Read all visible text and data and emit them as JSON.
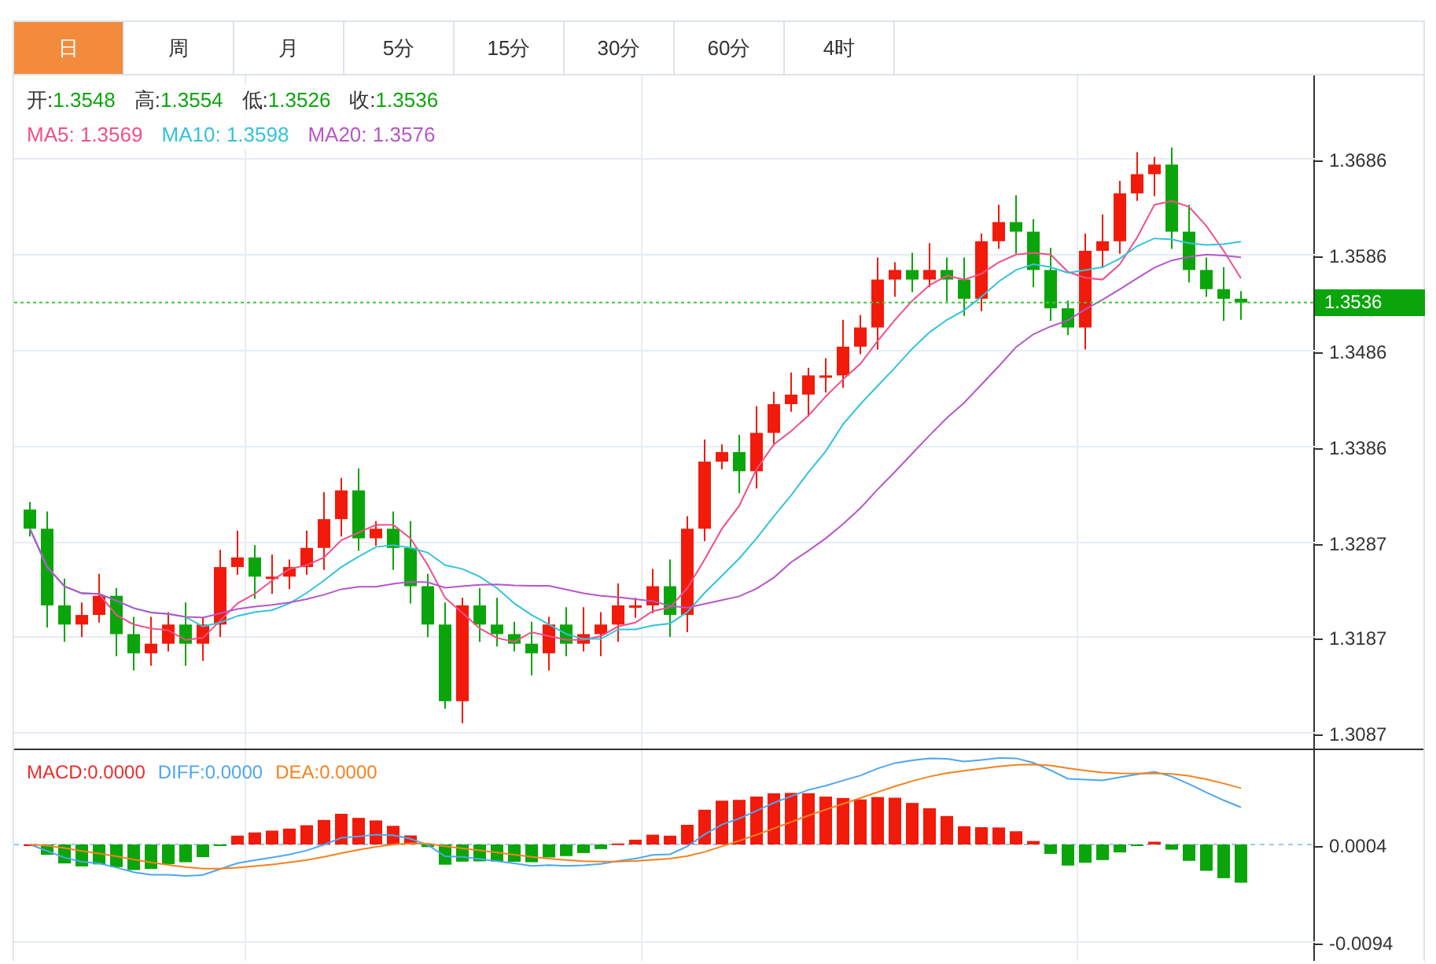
{
  "tabs": [
    {
      "label": "日",
      "selected": true
    },
    {
      "label": "周",
      "selected": false
    },
    {
      "label": "月",
      "selected": false
    },
    {
      "label": "5分",
      "selected": false
    },
    {
      "label": "15分",
      "selected": false
    },
    {
      "label": "30分",
      "selected": false
    },
    {
      "label": "60分",
      "selected": false
    },
    {
      "label": "4时",
      "selected": false
    }
  ],
  "quote": [
    {
      "label": "开:",
      "value": "1.3548"
    },
    {
      "label": "高:",
      "value": "1.3554"
    },
    {
      "label": "低:",
      "value": "1.3526"
    },
    {
      "label": "收:",
      "value": "1.3536"
    }
  ],
  "moving_averages": [
    {
      "label": "MA5:",
      "value": "1.3569",
      "color": "#f0508a"
    },
    {
      "label": "MA10:",
      "value": "1.3598",
      "color": "#33c3dc"
    },
    {
      "label": "MA20:",
      "value": "1.3576",
      "color": "#b657c8"
    }
  ],
  "price_axis": [
    "1.3686",
    "1.3586",
    "1.3486",
    "1.3386",
    "1.3287",
    "1.3187",
    "1.3087"
  ],
  "current_price": "1.3536",
  "macd_legend": [
    {
      "label": "MACD:",
      "value": "0.0000",
      "color": "#ee2b2b"
    },
    {
      "label": "DIFF:",
      "value": "0.0000",
      "color": "#4ea6f0"
    },
    {
      "label": "DEA:",
      "value": "0.0000",
      "color": "#f5821f"
    }
  ],
  "macd_axis": [
    "0.0004",
    "-0.0094"
  ]
}
